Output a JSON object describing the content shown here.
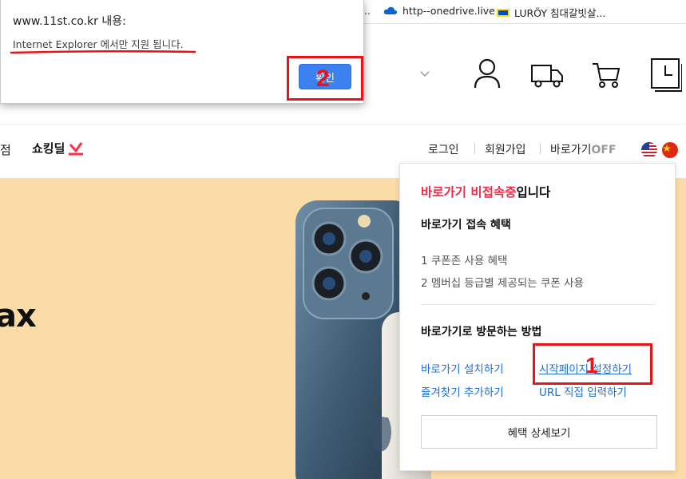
{
  "bookmarks": {
    "ellipsis": "...",
    "items": [
      {
        "label": "http--onedrive.live"
      },
      {
        "label": "LURÖY 침대갈빗살..."
      }
    ]
  },
  "nav": {
    "left_partial": "점",
    "shocking_deal": "쇼킹딜",
    "login": "로그인",
    "signup": "회원가입",
    "shortcut": "바로가기",
    "shortcut_state": "OFF"
  },
  "banner": {
    "partial_text": "ax"
  },
  "alert": {
    "title": "www.11st.co.kr 내용:",
    "message": "Internet Explorer 에서만 지원 됩니다.",
    "ok_label": "확인"
  },
  "panel": {
    "title_red": "바로가기 비접속중",
    "title_rest": "입니다",
    "benefits_heading": "바로가기 접속 혜택",
    "benefits": [
      "1 쿠폰존 사용 혜택",
      "2 멤버십 등급별 제공되는 쿠폰 사용"
    ],
    "methods_heading": "바로가기로 방문하는 방법",
    "links": {
      "install": "바로가기 설치하기",
      "homepage": "시작페이지 설정하기",
      "favorite": "즐겨찾기 추가하기",
      "url": "URL 직접 입력하기"
    },
    "detail_button": "혜택 상세보기"
  },
  "annotations": {
    "box1_number": "1",
    "box2_number": "2",
    "color": "#e8141a"
  }
}
